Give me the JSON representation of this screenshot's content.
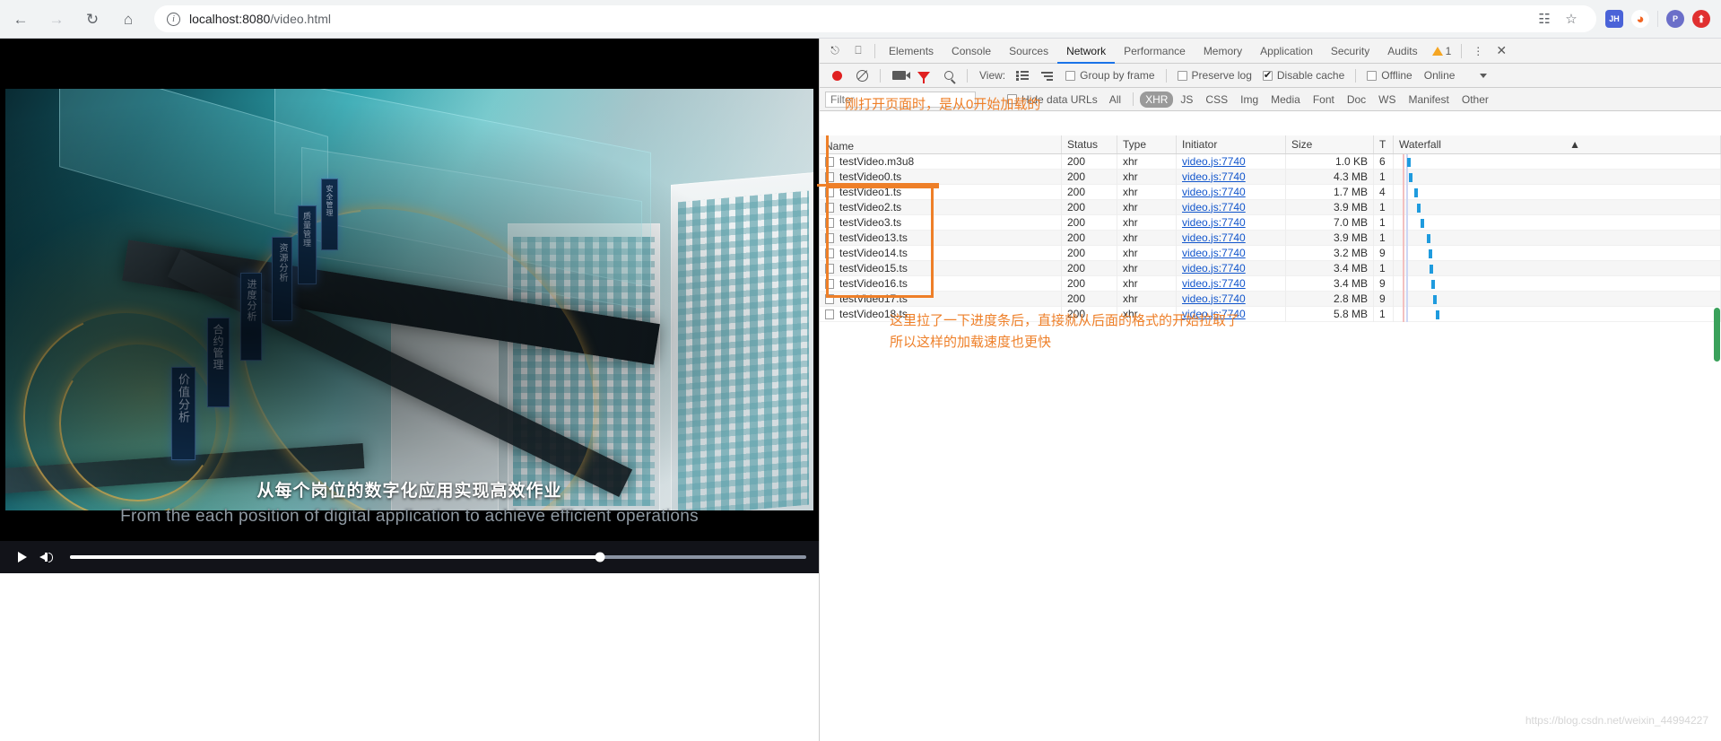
{
  "browser": {
    "back_icon": "back-arrow-icon",
    "forward_icon": "forward-arrow-icon",
    "reload_icon": "reload-icon",
    "home_icon": "home-icon",
    "url_host": "localhost:8080",
    "url_path": "/video.html",
    "info_glyph": "i",
    "translate_icon": "translate-icon",
    "bookmark_icon": "star-icon",
    "extensions": [
      {
        "name": "jh-extension",
        "label": "JH",
        "color": "#4a63d8",
        "shape": "square"
      },
      {
        "name": "flame-extension",
        "label": "◉",
        "color": "#ffffff",
        "shape": "round"
      },
      {
        "name": "profile-avatar",
        "label": "P",
        "color": "#6b6fc9",
        "shape": "round"
      },
      {
        "name": "upload-extension",
        "label": "⬆",
        "color": "#e03030",
        "shape": "round"
      }
    ]
  },
  "video": {
    "subtitle_cn": "从每个岗位的数字化应用实现高效作业",
    "subtitle_en": "From the each position of digital application to achieve efficient operations",
    "play_icon": "play-icon",
    "volume_icon": "volume-icon",
    "progress_percent": 72,
    "overlay_tags": [
      "价值分析",
      "合约管理",
      "进度分析",
      "资源分析",
      "质量管理",
      "安全管理"
    ]
  },
  "devtools": {
    "inspect_icon": "inspect-element-icon",
    "device_icon": "device-toolbar-icon",
    "tabs": [
      {
        "label": "Elements",
        "active": false
      },
      {
        "label": "Console",
        "active": false
      },
      {
        "label": "Sources",
        "active": false
      },
      {
        "label": "Network",
        "active": true
      },
      {
        "label": "Performance",
        "active": false
      },
      {
        "label": "Memory",
        "active": false
      },
      {
        "label": "Application",
        "active": false
      },
      {
        "label": "Security",
        "active": false
      },
      {
        "label": "Audits",
        "active": false
      }
    ],
    "warning_count": "1",
    "more_icon": "more-vertical-icon",
    "close_icon": "close-icon",
    "toolbar": {
      "record_icon": "record-button",
      "clear_icon": "clear-icon",
      "capture_screenshots_icon": "camera-icon",
      "filter_icon": "funnel-icon",
      "search_icon": "search-icon",
      "view_label": "View:",
      "view_list_icon": "list-view-icon",
      "view_waterfall_icon": "waterfall-view-icon",
      "group_by_frame": "Group by frame",
      "group_by_frame_checked": false,
      "preserve_log": "Preserve log",
      "preserve_log_checked": false,
      "disable_cache": "Disable cache",
      "disable_cache_checked": true,
      "offline": "Offline",
      "offline_checked": false,
      "throttling": "Online",
      "throttling_caret": "chevron-down-icon"
    },
    "filterbar": {
      "filter_placeholder": "Filter",
      "filter_value": "",
      "hide_data_urls": "Hide data URLs",
      "hide_data_urls_checked": false,
      "types": [
        "All",
        "XHR",
        "JS",
        "CSS",
        "Img",
        "Media",
        "Font",
        "Doc",
        "WS",
        "Manifest",
        "Other"
      ],
      "active_type": "XHR"
    },
    "table": {
      "columns": [
        "Name",
        "Status",
        "Type",
        "Initiator",
        "Size",
        "T",
        "Waterfall"
      ],
      "sort_icon": "sort-asc-icon",
      "rows": [
        {
          "name": "testVideo.m3u8",
          "status": "200",
          "type": "xhr",
          "initiator": "video.js:7740",
          "size": "1.0 KB",
          "time": "6",
          "wf": 3
        },
        {
          "name": "testVideo0.ts",
          "status": "200",
          "type": "xhr",
          "initiator": "video.js:7740",
          "size": "4.3 MB",
          "time": "1",
          "wf": 5
        },
        {
          "name": "testVideo1.ts",
          "status": "200",
          "type": "xhr",
          "initiator": "video.js:7740",
          "size": "1.7 MB",
          "time": "4",
          "wf": 11
        },
        {
          "name": "testVideo2.ts",
          "status": "200",
          "type": "xhr",
          "initiator": "video.js:7740",
          "size": "3.9 MB",
          "time": "1",
          "wf": 14
        },
        {
          "name": "testVideo3.ts",
          "status": "200",
          "type": "xhr",
          "initiator": "video.js:7740",
          "size": "7.0 MB",
          "time": "1",
          "wf": 18
        },
        {
          "name": "testVideo13.ts",
          "status": "200",
          "type": "xhr",
          "initiator": "video.js:7740",
          "size": "3.9 MB",
          "time": "1",
          "wf": 25
        },
        {
          "name": "testVideo14.ts",
          "status": "200",
          "type": "xhr",
          "initiator": "video.js:7740",
          "size": "3.2 MB",
          "time": "9",
          "wf": 27
        },
        {
          "name": "testVideo15.ts",
          "status": "200",
          "type": "xhr",
          "initiator": "video.js:7740",
          "size": "3.4 MB",
          "time": "1",
          "wf": 28
        },
        {
          "name": "testVideo16.ts",
          "status": "200",
          "type": "xhr",
          "initiator": "video.js:7740",
          "size": "3.4 MB",
          "time": "9",
          "wf": 30
        },
        {
          "name": "testVideo17.ts",
          "status": "200",
          "type": "xhr",
          "initiator": "video.js:7740",
          "size": "2.8 MB",
          "time": "9",
          "wf": 32
        },
        {
          "name": "testVideo18.ts",
          "status": "200",
          "type": "xhr",
          "initiator": "video.js:7740",
          "size": "5.8 MB",
          "time": "1",
          "wf": 35
        }
      ]
    },
    "annotations": {
      "top_note": "刚打开页面时，是从0开始加载的",
      "bottom_note": "这里拉了一下进度条后，直接就从后面的格式的开始拉取了\n所以这样的加载速度也更快",
      "color": "#ee7f28"
    },
    "watermark": "https://blog.csdn.net/weixin_44994227"
  }
}
